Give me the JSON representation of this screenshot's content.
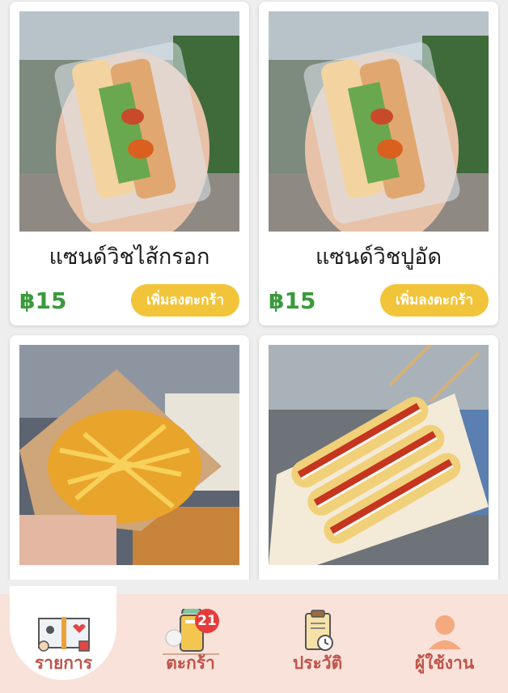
{
  "products": [
    {
      "name": "แซนด์วิชไส้กรอก",
      "price": "฿15",
      "button": "เพิ่มลงตะกร้า",
      "image_icon": "sausage-sandwich-photo"
    },
    {
      "name": "แซนด์วิชปูอัด",
      "price": "฿15",
      "button": "เพิ่มลงตะกร้า",
      "image_icon": "crab-stick-sandwich-photo"
    },
    {
      "name": "",
      "price": "",
      "button": "",
      "image_icon": "cheese-fries-photo"
    },
    {
      "name": "",
      "price": "",
      "button": "",
      "image_icon": "sausage-skewers-photo"
    }
  ],
  "tabs": [
    {
      "label": "รายการ",
      "icon": "menu-book-icon",
      "active": true
    },
    {
      "label": "ตะกร้า",
      "icon": "basket-icon",
      "badge": "21"
    },
    {
      "label": "ประวัติ",
      "icon": "clipboard-history-icon"
    },
    {
      "label": "ผู้ใช้งาน",
      "icon": "user-icon"
    }
  ],
  "colors": {
    "price_green": "#3a9a3b",
    "button_yellow": "#f2c43a",
    "tab_label": "#c0534a",
    "tabbar_bg": "#f8e2d9",
    "badge_red": "#e63b3b"
  }
}
